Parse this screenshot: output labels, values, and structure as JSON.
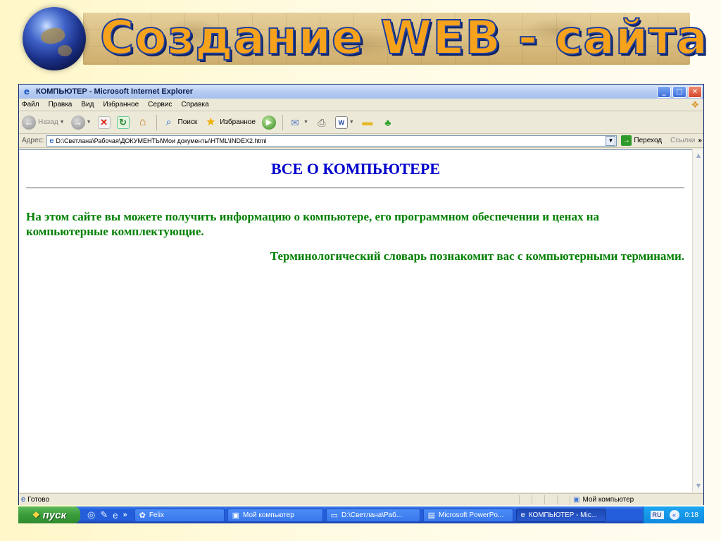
{
  "slide": {
    "title": "Создание WEB - сайта"
  },
  "window": {
    "title": "КОМПЬЮТЕР - Microsoft Internet Explorer",
    "controls": {
      "minimize": "_",
      "maximize": "□",
      "close": "✕"
    }
  },
  "menu": {
    "items": [
      "Файл",
      "Правка",
      "Вид",
      "Избранное",
      "Сервис",
      "Справка"
    ]
  },
  "toolbar": {
    "back_label": "Назад",
    "search_label": "Поиск",
    "favorites_label": "Избранное",
    "icons": [
      "back-arrow",
      "forward-arrow",
      "stop",
      "refresh",
      "home",
      "search",
      "star",
      "media",
      "mail",
      "print",
      "word",
      "folder",
      "messenger"
    ]
  },
  "address": {
    "label": "Адрес:",
    "value": "D:\\Светлана\\Рабочая\\ДОКУМЕНТЫ\\Мои документы\\HTML\\INDEX2.html",
    "go_label": "Переход",
    "links_label": "Ссылки",
    "more": "»"
  },
  "page": {
    "heading": "ВСЕ О КОМПЬЮТЕРЕ",
    "paragraph1": "На этом сайте вы можете получить информацию о компьютере, его программном обеспечении и ценах на компьютерные комплектующие.",
    "paragraph2": "Терминологический словарь познакомит вас с компьютерными терминами."
  },
  "status": {
    "text": "Готово",
    "zone": "Мой компьютер"
  },
  "taskbar": {
    "start_label": "пуск",
    "quicklaunch_more": "»",
    "tasks": [
      {
        "label": "Felix",
        "active": false
      },
      {
        "label": "Мой компьютер",
        "active": false
      },
      {
        "label": "D:\\Светлана\\Раб...",
        "active": false
      },
      {
        "label": "Microsoft PowerPo...",
        "active": false
      },
      {
        "label": "КОМПЬЮТЕР - Mic...",
        "active": true
      }
    ],
    "language": "RU",
    "clock": "0:18"
  }
}
